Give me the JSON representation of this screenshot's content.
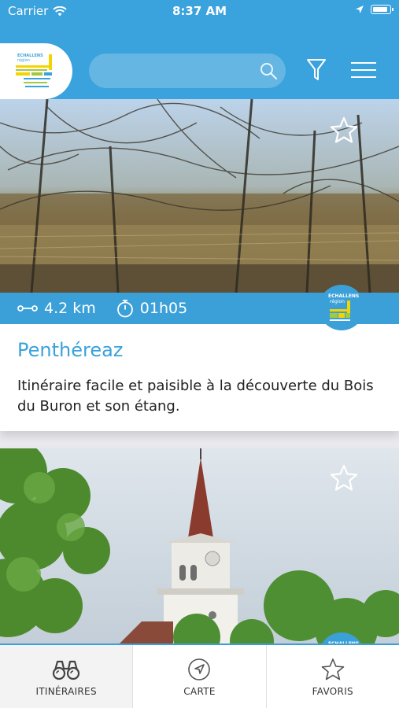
{
  "status_bar": {
    "carrier": "Carrier",
    "time": "8:37 AM",
    "battery_level": 0.9
  },
  "header": {
    "logo_text": [
      "ECHALLENS",
      "région"
    ],
    "search": {
      "placeholder": "",
      "value": ""
    },
    "icons": [
      "search-icon",
      "filter-icon",
      "menu-icon"
    ]
  },
  "cards": [
    {
      "distance": "4.2 km",
      "duration": "01h05",
      "title": "Penthéreaz",
      "description": "Itinéraire facile et paisible à la découverte du Bois du Buron et son étang.",
      "favorite": false
    },
    {
      "favorite": false
    }
  ],
  "tabs": [
    {
      "label": "ITINÉRAIRES",
      "icon": "binoculars-icon",
      "active": true
    },
    {
      "label": "CARTE",
      "icon": "navigation-icon",
      "active": false
    },
    {
      "label": "FAVORIS",
      "icon": "star-icon",
      "active": false
    }
  ],
  "colors": {
    "brand": "#3aa2dc",
    "title": "#3aa2dc"
  }
}
